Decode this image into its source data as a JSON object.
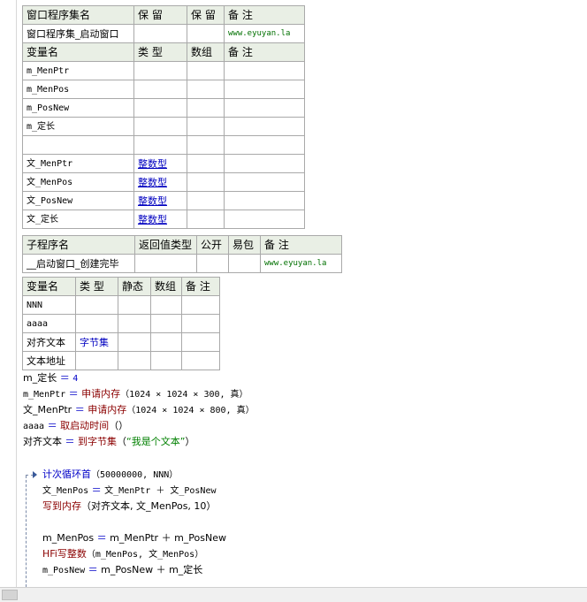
{
  "window_table": {
    "headers": [
      "窗口程序集名",
      "保 留",
      "保 留",
      "备 注"
    ],
    "row": {
      "name": "窗口程序集_启动窗口",
      "keep1": "",
      "keep2": "",
      "note": "www.eyuyan.la"
    },
    "var_headers": [
      "变量名",
      "类 型",
      "数组",
      "备 注"
    ],
    "vars": [
      {
        "name": "m_MenPtr",
        "type": ""
      },
      {
        "name": "m_MenPos",
        "type": ""
      },
      {
        "name": "m_PosNew",
        "type": ""
      },
      {
        "name": "m_定长",
        "type": ""
      },
      {
        "name": "",
        "type": ""
      },
      {
        "name": "文_MenPtr",
        "type": "整数型"
      },
      {
        "name": "文_MenPos",
        "type": "整数型"
      },
      {
        "name": "文_PosNew",
        "type": "整数型"
      },
      {
        "name": "文_定长",
        "type": "整数型"
      }
    ]
  },
  "sub_table": {
    "headers": [
      "子程序名",
      "返回值类型",
      "公开",
      "易包",
      "备 注"
    ],
    "row": {
      "name": "__启动窗口_创建完毕",
      "note": "www.eyuyan.la"
    }
  },
  "local_table": {
    "headers": [
      "变量名",
      "类 型",
      "静态",
      "数组",
      "备 注"
    ],
    "vars": [
      {
        "name": "NNN",
        "type": ""
      },
      {
        "name": "aaaa",
        "type": ""
      },
      {
        "name": "对齐文本",
        "type": "字节集"
      },
      {
        "name": "文本地址",
        "type": ""
      }
    ]
  },
  "code": {
    "l1": {
      "lhs": "m_定长",
      "op": "＝",
      "rhs": "4"
    },
    "l2": {
      "lhs": "m_MenPtr",
      "op": "＝",
      "fn": "申请内存",
      "args": "（1024 × 1024 × 300, 真）"
    },
    "l3": {
      "lhs": "文_MenPtr",
      "op": "＝",
      "fn": "申请内存",
      "args": "（1024 × 1024 × 800, 真）"
    },
    "l4": {
      "lhs": "aaaa",
      "op": "＝",
      "fn": "取启动时间",
      "args": "（）"
    },
    "l5": {
      "lhs": "对齐文本",
      "op": "＝",
      "fn": "到字节集",
      "args_open": "（",
      "str": "“我是个文本”",
      "args_close": "）"
    },
    "loop": {
      "kw": "计次循环首",
      "args": "（50000000, NNN）"
    },
    "b1": {
      "lhs": "文_MenPos",
      "op": "＝",
      "rhs": "文_MenPtr ＋ 文_PosNew"
    },
    "b2": {
      "fn": "写到内存",
      "args": "（对齐文本, 文_MenPos, 10）"
    },
    "b3": {
      "lhs": "m_MenPos",
      "op": "＝",
      "rhs": "m_MenPtr ＋ m_PosNew"
    },
    "b4": {
      "fn": "HFi写整数",
      "args": "（m_MenPos, 文_MenPos）"
    },
    "b5": {
      "lhs": "m_PosNew",
      "op": "＝",
      "rhs": "m_PosNew ＋ m_定长"
    }
  },
  "colors": {
    "header_bg": "#e9efe5",
    "border": "#a9a9a9",
    "keyword_blue": "#0000c8",
    "function_red": "#8b0000",
    "string_green": "#008000",
    "url_green": "#007000"
  }
}
